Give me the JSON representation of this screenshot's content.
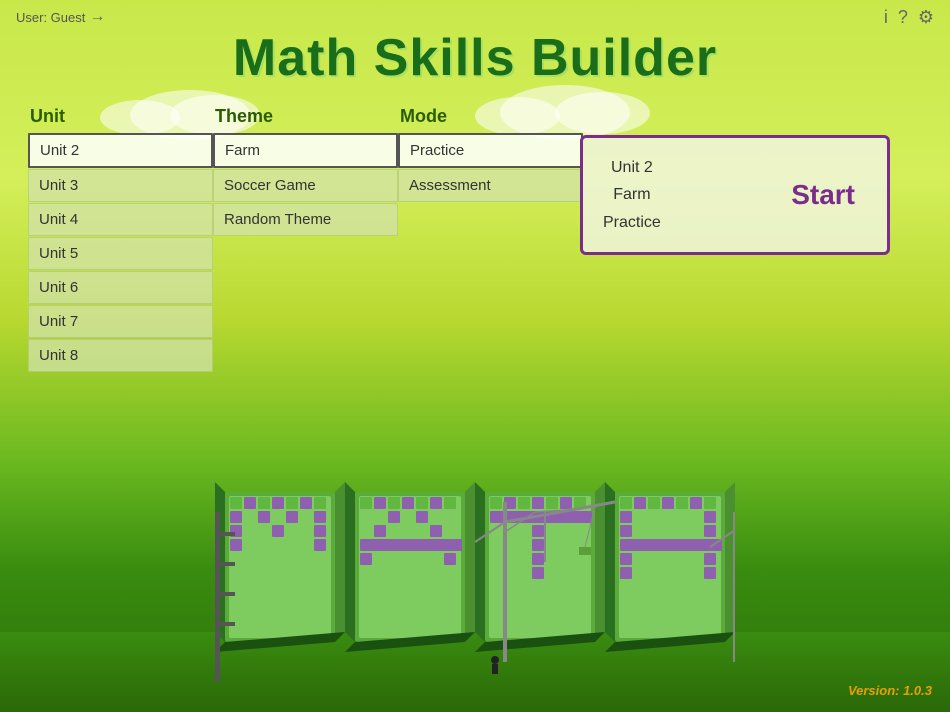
{
  "topbar": {
    "user_label": "User: Guest",
    "logout_icon": "→",
    "info_icon": "i",
    "help_icon": "?",
    "settings_icon": "⚙"
  },
  "title": "Math Skills Builder",
  "columns": {
    "unit": {
      "header": "Unit",
      "items": [
        {
          "label": "Unit 2",
          "selected": true
        },
        {
          "label": "Unit 3",
          "selected": false
        },
        {
          "label": "Unit 4",
          "selected": false
        },
        {
          "label": "Unit 5",
          "selected": false
        },
        {
          "label": "Unit 6",
          "selected": false
        },
        {
          "label": "Unit 7",
          "selected": false
        },
        {
          "label": "Unit 8",
          "selected": false
        }
      ]
    },
    "theme": {
      "header": "Theme",
      "items": [
        {
          "label": "Farm",
          "selected": true
        },
        {
          "label": "Soccer Game",
          "selected": false
        },
        {
          "label": "Random Theme",
          "selected": false
        }
      ]
    },
    "mode": {
      "header": "Mode",
      "items": [
        {
          "label": "Practice",
          "selected": true
        },
        {
          "label": "Assessment",
          "selected": false
        }
      ]
    }
  },
  "start_panel": {
    "unit": "Unit 2",
    "theme": "Farm",
    "mode": "Practice",
    "button_label": "Start"
  },
  "version": "Version: 1.0.3"
}
